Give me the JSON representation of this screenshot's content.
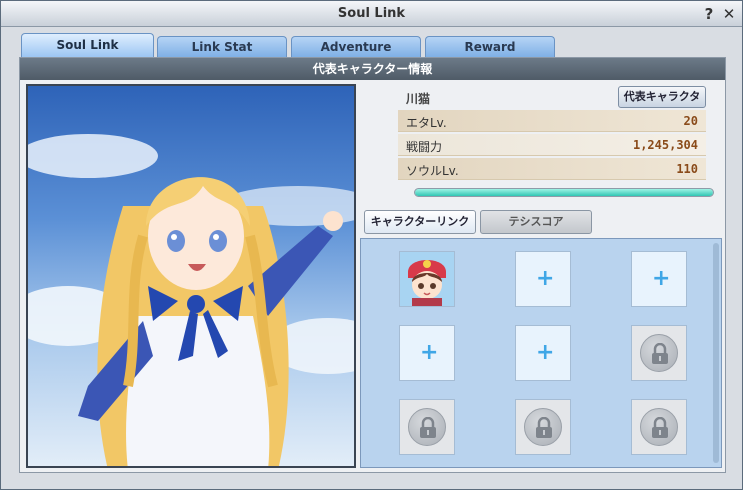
{
  "window": {
    "title": "Soul Link",
    "help": "?",
    "close": "✕"
  },
  "tabs": [
    {
      "label": "Soul Link",
      "active": true
    },
    {
      "label": "Link Stat",
      "active": false
    },
    {
      "label": "Adventure",
      "active": false
    },
    {
      "label": "Reward",
      "active": false
    }
  ],
  "section_header": "代表キャラクター情報",
  "info": {
    "character_name": "川猫",
    "rep_button": "代表キャラクター",
    "stats": [
      {
        "label": "エタLv.",
        "value": "20"
      },
      {
        "label": "戦闘力",
        "value": "1,245,304"
      },
      {
        "label": "ソウルLv.",
        "value": "110"
      }
    ],
    "progress_fraction": 1.0
  },
  "subtabs": {
    "active": "キャラクターリンク",
    "inactive": "テシスコア"
  },
  "slots": [
    {
      "state": "filled",
      "icon": "character-avatar"
    },
    {
      "state": "empty",
      "icon": "plus-icon"
    },
    {
      "state": "empty",
      "icon": "plus-icon"
    },
    {
      "state": "empty",
      "icon": "plus-icon"
    },
    {
      "state": "empty",
      "icon": "plus-icon"
    },
    {
      "state": "locked",
      "icon": "lock-icon"
    },
    {
      "state": "locked",
      "icon": "lock-icon"
    },
    {
      "state": "locked",
      "icon": "lock-icon"
    },
    {
      "state": "locked",
      "icon": "lock-icon"
    }
  ],
  "plus_glyph": "+",
  "colors": {
    "tab_active": "#9cc6f3",
    "header_bg": "#5a6774",
    "stat_value": "#8a4b1a",
    "progress": "#30c6b3",
    "grid_bg": "#b9d3ee"
  }
}
